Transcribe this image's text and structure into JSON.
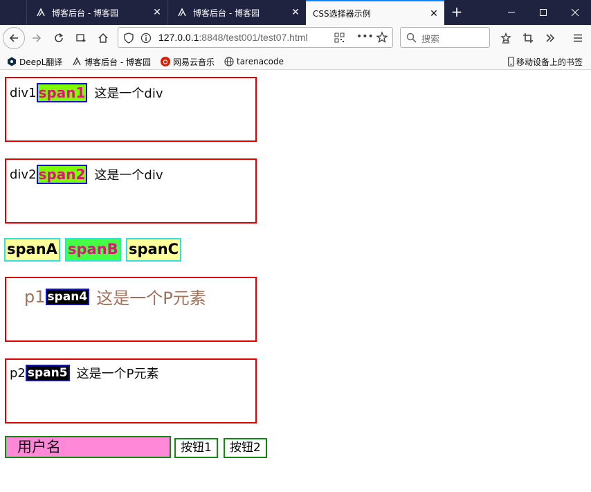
{
  "tabs": [
    {
      "title": "博客后台 - 博客园",
      "active": false
    },
    {
      "title": "博客后台 - 博客园",
      "active": false
    },
    {
      "title": "CSS选择器示例",
      "active": true
    }
  ],
  "navbar": {
    "url_host": "127.0.0.1",
    "url_rest": ":8848/test001/test07.html",
    "search_placeholder": "搜索"
  },
  "bookmarks": {
    "items": [
      "DeepL翻译",
      "博客后台 - 博客园",
      "网易云音乐",
      "tarenacode"
    ],
    "mobile": "移动设备上的书签"
  },
  "page": {
    "div1": {
      "prefix": "div1",
      "span": "span1",
      "suffix": "这是一个div"
    },
    "div2": {
      "prefix": "div2",
      "span": "span2",
      "suffix": "这是一个div"
    },
    "spans": [
      "spanA",
      "spanB",
      "spanC"
    ],
    "p1": {
      "prefix": "p1",
      "span": "span4",
      "suffix": "这是一个P元素"
    },
    "p2": {
      "prefix": "p2",
      "span": "span5",
      "suffix": "这是一个P元素"
    },
    "input_value": "用户名",
    "buttons": [
      "按钮1",
      "按钮2"
    ]
  },
  "colors": {
    "title_bar": "#202340",
    "box_border": "#e00000",
    "span_green_bg": "#7cfc00",
    "span_pink_text": "#e0157a",
    "span_blue_border": "#1010d0",
    "input_bg": "#ff88d8",
    "green_border": "#118811"
  }
}
